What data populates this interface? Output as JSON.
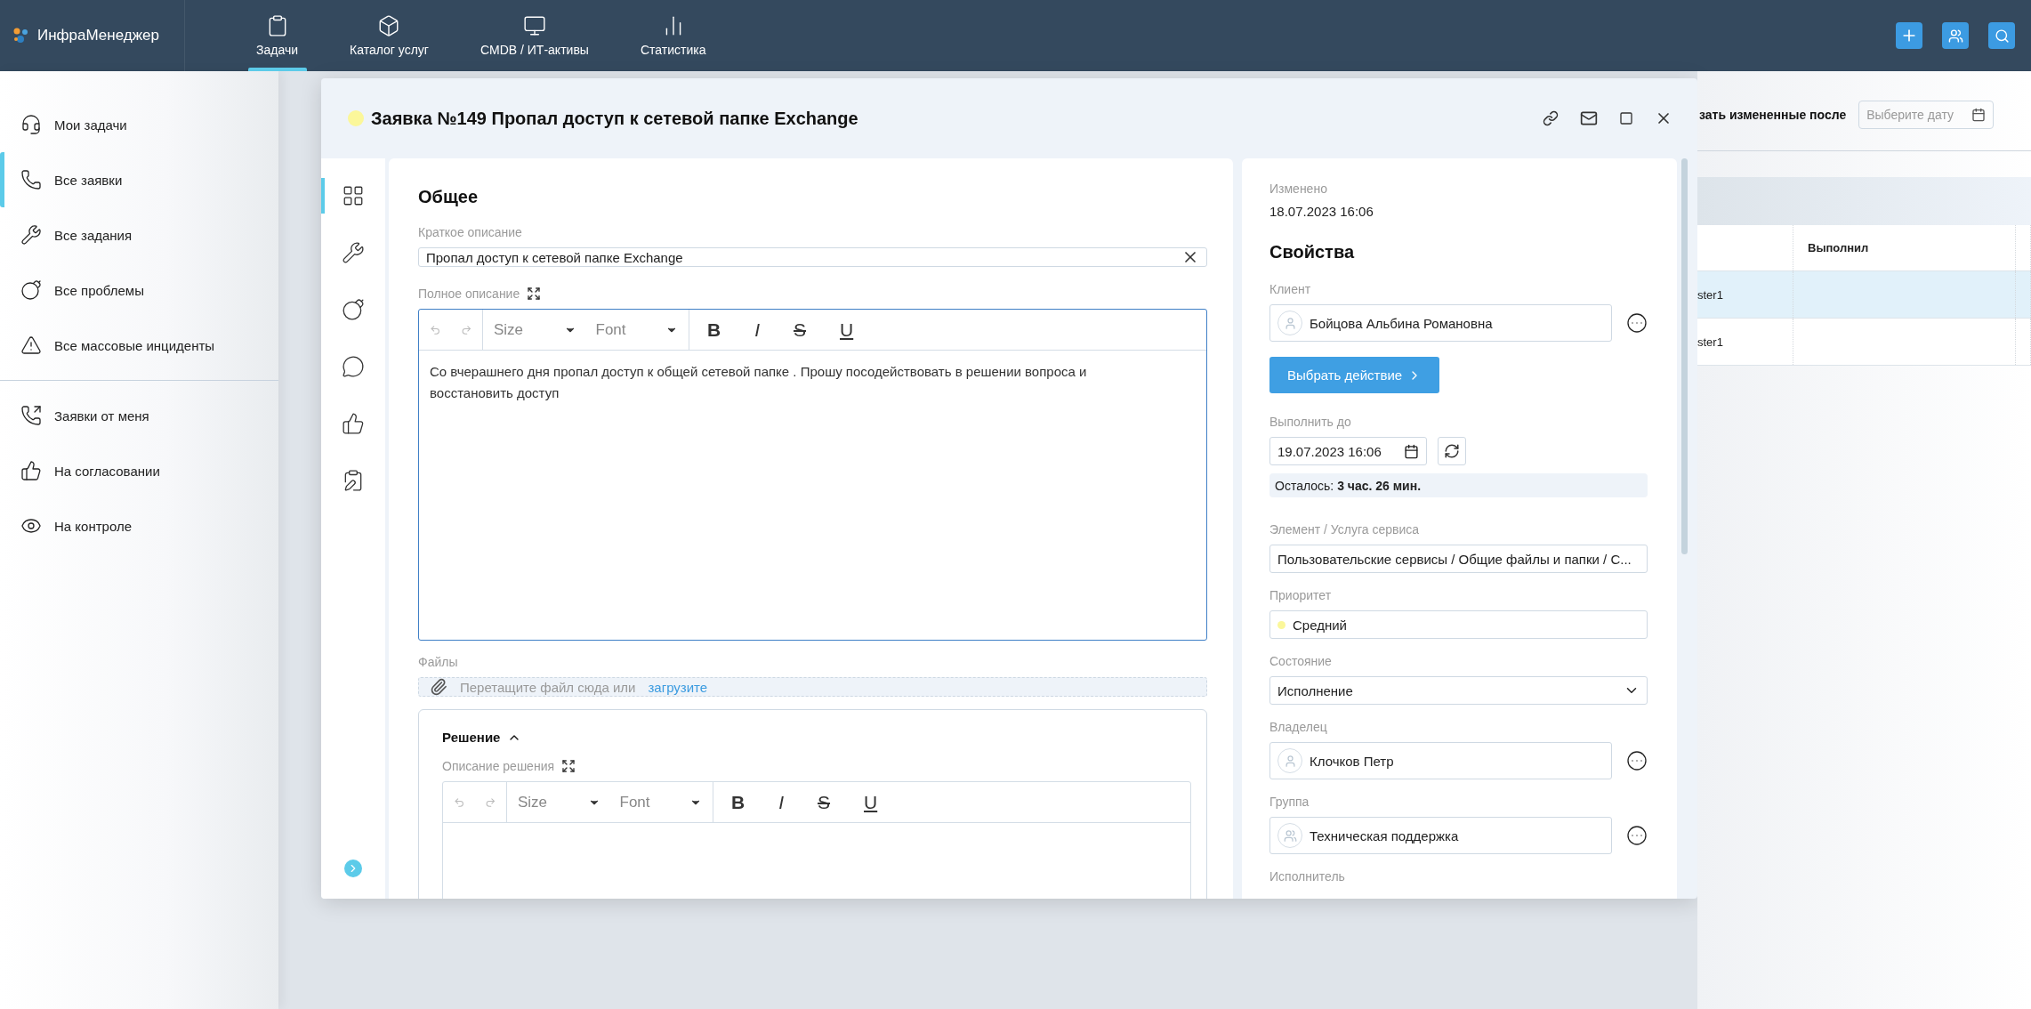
{
  "topbar": {
    "brand": "ИнфраМенеджер",
    "tabs": [
      {
        "label": "Задачи",
        "selected": true
      },
      {
        "label": "Каталог услуг",
        "selected": false
      },
      {
        "label": "CMDB / ИТ-активы",
        "selected": false
      },
      {
        "label": "Статистика",
        "selected": false
      }
    ]
  },
  "sidebar": {
    "groups": [
      {
        "items": [
          {
            "label": "Мои задачи",
            "selected": false
          },
          {
            "label": "Все заявки",
            "selected": true
          },
          {
            "label": "Все задания",
            "selected": false
          },
          {
            "label": "Все проблемы",
            "selected": false
          },
          {
            "label": "Все массовые инциденты",
            "selected": false
          }
        ]
      },
      {
        "items": [
          {
            "label": "Заявки от меня",
            "selected": false
          },
          {
            "label": "На согласовании",
            "selected": false
          },
          {
            "label": "На контроле",
            "selected": false
          }
        ]
      }
    ]
  },
  "modal": {
    "title": "Заявка №149 Пропал доступ к сетевой папке Exchange",
    "rail": [
      {
        "selected": true
      },
      {
        "selected": false
      },
      {
        "selected": false
      },
      {
        "selected": false
      },
      {
        "selected": false
      },
      {
        "selected": false
      }
    ],
    "general": {
      "heading": "Общее",
      "short_label": "Краткое описание",
      "short_value": "Пропал доступ к сетевой папке Exchange",
      "full_label": "Полное описание",
      "editor": {
        "history_disabled": true,
        "size": "Size",
        "font": "Font",
        "format": [
          "B",
          "I",
          "S",
          "U"
        ],
        "text": "Со вчерашнего дня пропал доступ к общей сетевой папке . Прошу посодействовать в решении вопроса и восстановить доступ"
      },
      "files_label": "Файлы",
      "files_hint": "Перетащите файл сюда или",
      "files_link": "загрузите"
    },
    "solution": {
      "heading": "Решение",
      "expanded": true,
      "label": "Описание решения",
      "editor": {
        "history_disabled": true,
        "size": "Size",
        "font": "Font",
        "format": [
          "B",
          "I",
          "S",
          "U"
        ]
      }
    },
    "properties": {
      "changed_label": "Изменено",
      "changed_value": "18.07.2023 16:06",
      "heading": "Свойства",
      "client": {
        "label": "Клиент",
        "value": "Бойцова Альбина Романовна",
        "kind": "person"
      },
      "action_button": "Выбрать действие",
      "due_label": "Выполнить до",
      "due_value": "19.07.2023 16:06",
      "remaining": "Осталось: **3 час. 26 мин.**",
      "fields": [
        {
          "kind": "text",
          "label": "Элемент / Услуга сервиса",
          "value": "Пользовательские сервисы / Общие файлы и папки / С..."
        },
        {
          "kind": "priority",
          "label": "Приоритет",
          "value": "Средний",
          "color": "#fbf79a"
        },
        {
          "kind": "select",
          "label": "Состояние",
          "value": "Исполнение"
        },
        {
          "kind": "person",
          "label": "Владелец",
          "value": "Клочков Петр"
        },
        {
          "kind": "group",
          "label": "Группа",
          "value": "Техническая поддержка"
        }
      ],
      "cut_label": "Исполнитель"
    }
  },
  "background": {
    "filter_label": "зать измененные после",
    "date_placeholder": "Выберите дату",
    "table": {
      "columns": [
        "Выполнил"
      ],
      "rows": [
        {
          "column_1": "ster1",
          "selected": true
        },
        {
          "column_1": "ster1",
          "selected": false
        }
      ]
    }
  }
}
